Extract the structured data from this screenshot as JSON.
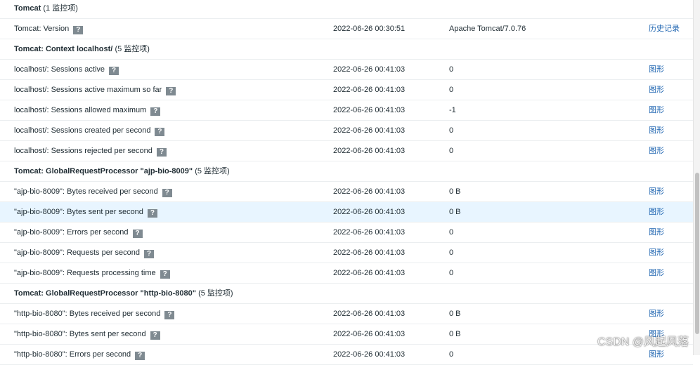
{
  "groups": [
    {
      "title": "Tomcat",
      "count": "(1 监控项)",
      "items": [
        {
          "name": "Tomcat: Version",
          "time": "2022-06-26 00:30:51",
          "value": "Apache Tomcat/7.0.76",
          "link": "历史记录"
        }
      ]
    },
    {
      "title": "Tomcat: Context localhost/",
      "count": "(5 监控项)",
      "items": [
        {
          "name": "localhost/: Sessions active",
          "time": "2022-06-26 00:41:03",
          "value": "0",
          "link": "图形"
        },
        {
          "name": "localhost/: Sessions active maximum so far",
          "time": "2022-06-26 00:41:03",
          "value": "0",
          "link": "图形"
        },
        {
          "name": "localhost/: Sessions allowed maximum",
          "time": "2022-06-26 00:41:03",
          "value": "-1",
          "link": "图形"
        },
        {
          "name": "localhost/: Sessions created per second",
          "time": "2022-06-26 00:41:03",
          "value": "0",
          "link": "图形"
        },
        {
          "name": "localhost/: Sessions rejected per second",
          "time": "2022-06-26 00:41:03",
          "value": "0",
          "link": "图形"
        }
      ]
    },
    {
      "title": "Tomcat: GlobalRequestProcessor \"ajp-bio-8009\"",
      "count": "(5 监控项)",
      "items": [
        {
          "name": "\"ajp-bio-8009\": Bytes received per second",
          "time": "2022-06-26 00:41:03",
          "value": "0 B",
          "link": "图形"
        },
        {
          "name": "\"ajp-bio-8009\": Bytes sent per second",
          "time": "2022-06-26 00:41:03",
          "value": "0 B",
          "link": "图形",
          "highlight": true
        },
        {
          "name": "\"ajp-bio-8009\": Errors per second",
          "time": "2022-06-26 00:41:03",
          "value": "0",
          "link": "图形"
        },
        {
          "name": "\"ajp-bio-8009\": Requests per second",
          "time": "2022-06-26 00:41:03",
          "value": "0",
          "link": "图形"
        },
        {
          "name": "\"ajp-bio-8009\": Requests processing time",
          "time": "2022-06-26 00:41:03",
          "value": "0",
          "link": "图形"
        }
      ]
    },
    {
      "title": "Tomcat: GlobalRequestProcessor \"http-bio-8080\"",
      "count": "(5 监控项)",
      "items": [
        {
          "name": "\"http-bio-8080\": Bytes received per second",
          "time": "2022-06-26 00:41:03",
          "value": "0 B",
          "link": "图形"
        },
        {
          "name": "\"http-bio-8080\": Bytes sent per second",
          "time": "2022-06-26 00:41:03",
          "value": "0 B",
          "link": "图形"
        },
        {
          "name": "\"http-bio-8080\": Errors per second",
          "time": "2022-06-26 00:41:03",
          "value": "0",
          "link": "图形"
        }
      ]
    }
  ],
  "help_icon": {
    "name": "help-icon",
    "glyph": "?"
  },
  "watermark": "CSDN @风起风落",
  "colors": {
    "link": "#1f65b1",
    "highlight_row": "#e8f5ff",
    "help_icon_bg": "#7f8a91"
  }
}
